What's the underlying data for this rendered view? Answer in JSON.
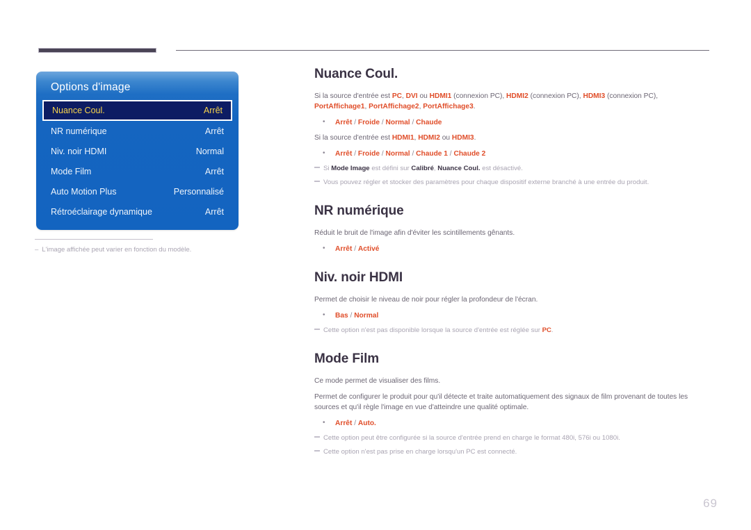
{
  "page": {
    "number": "69"
  },
  "osd": {
    "title": "Options d'image",
    "items": [
      {
        "label": "Nuance Coul.",
        "value": "Arrêt",
        "selected": true
      },
      {
        "label": "NR numérique",
        "value": "Arrêt",
        "selected": false
      },
      {
        "label": "Niv. noir HDMI",
        "value": "Normal",
        "selected": false
      },
      {
        "label": "Mode Film",
        "value": "Arrêt",
        "selected": false
      },
      {
        "label": "Auto Motion Plus",
        "value": "Personnalisé",
        "selected": false
      },
      {
        "label": "Rétroéclairage dynamique",
        "value": "Arrêt",
        "selected": false
      }
    ]
  },
  "caption": {
    "dash": "–",
    "text": "L'image affichée peut varier en fonction du modèle."
  },
  "sections": [
    {
      "id": "nuance-coul",
      "title": "Nuance Coul.",
      "para1_a": "Si la source d'entrée est ",
      "para1_pc": "PC",
      "para1_b": ", ",
      "para1_dvi": "DVI",
      "para1_c": " ou ",
      "para1_hdmi1": "HDMI1",
      "para1_d": " (connexion PC), ",
      "para1_hdmi2": "HDMI2",
      "para1_e": " (connexion PC), ",
      "para1_hdmi3": "HDMI3",
      "para1_f": " (connexion PC),",
      "para1_pa1": "PortAffichage1",
      "para1_g": ", ",
      "para1_pa2": "PortAffichage2",
      "para1_h": ", ",
      "para1_pa3": "PortAffichage3",
      "para1_i": ".",
      "bullet1": [
        "Arrêt",
        "Froide",
        "Normal",
        "Chaude"
      ],
      "para2_a": "Si la source d'entrée est ",
      "para2_hdmi1": "HDMI1",
      "para2_b": ", ",
      "para2_hdmi2": "HDMI2",
      "para2_c": " ou ",
      "para2_hdmi3": "HDMI3",
      "para2_d": ".",
      "bullet2": [
        "Arrêt",
        "Froide",
        "Normal",
        "Chaude 1",
        "Chaude 2"
      ],
      "note1_a": "Si ",
      "note1_mode": "Mode Image",
      "note1_b": " est défini sur ",
      "note1_calibre": "Calibré",
      "note1_c": ", ",
      "note1_nuance": "Nuance Coul.",
      "note1_d": " est désactivé.",
      "note2": "Vous pouvez régler et stocker des paramètres pour chaque dispositif externe branché à une entrée du produit."
    },
    {
      "id": "nr-numerique",
      "title": "NR numérique",
      "para1": "Réduit le bruit de l'image afin d'éviter les scintillements gênants.",
      "bullet1": [
        "Arrêt",
        "Activé"
      ]
    },
    {
      "id": "niv-noir-hdmi",
      "title": "Niv. noir HDMI",
      "para1": "Permet de choisir le niveau de noir pour régler la profondeur de l'écran.",
      "bullet1": [
        "Bas",
        "Normal"
      ],
      "note1_a": "Cette option n'est pas disponible lorsque la source d'entrée est réglée sur ",
      "note1_pc": "PC",
      "note1_b": "."
    },
    {
      "id": "mode-film",
      "title": "Mode Film",
      "para1": "Ce mode permet de visualiser des films.",
      "para2": "Permet de configurer le produit pour qu'il détecte et traite automatiquement des signaux de film provenant de toutes les sources et qu'il règle l'image en vue d'atteindre une qualité optimale.",
      "bullet1": [
        "Arrêt",
        "Auto."
      ],
      "note1": "Cette option peut être configurée si la source d'entrée prend en charge le format 480i, 576i ou 1080i.",
      "note2": "Cette option n'est pas prise en charge lorsqu'un PC est connecté."
    }
  ],
  "colors": {
    "accent_orange": "#e04e2a",
    "heading": "#3a3244",
    "osd_blue": "#1565c0",
    "osd_selected_bg": "#0d1c63",
    "osd_selected_text": "#f8d44c"
  }
}
